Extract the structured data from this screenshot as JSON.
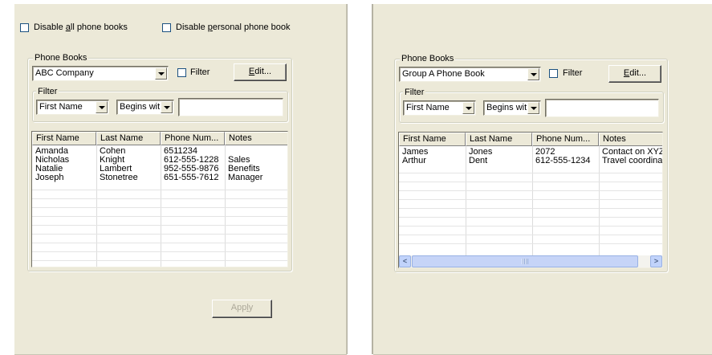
{
  "left": {
    "disable_all_label_pre": "Disable ",
    "disable_all_label_ul": "a",
    "disable_all_label_post": "ll phone books",
    "disable_personal_label_pre": "Disable ",
    "disable_personal_label_ul": "p",
    "disable_personal_label_post": "ersonal phone book",
    "phone_books_legend": "Phone Books",
    "phone_book_value": "ABC Company",
    "filter_check_label": "Filter",
    "edit_pre": "",
    "edit_ul": "E",
    "edit_post": "dit...",
    "filter_legend": "Filter",
    "filter_field_value": "First Name",
    "filter_op_value": "Begins wit",
    "filter_text_value": "",
    "columns": [
      "First Name",
      "Last Name",
      "Phone Num...",
      "Notes"
    ],
    "rows": [
      [
        "Amanda",
        "Cohen",
        "6511234",
        ""
      ],
      [
        "Nicholas",
        "Knight",
        "612-555-1228",
        "Sales"
      ],
      [
        "Natalie",
        "Lambert",
        "952-555-9876",
        "Benefits"
      ],
      [
        "Joseph",
        "Stonetree",
        "651-555-7612",
        "Manager"
      ]
    ],
    "apply_pre": "App",
    "apply_ul": "l",
    "apply_post": "y"
  },
  "right": {
    "phone_books_legend": "Phone Books",
    "phone_book_value": "Group A Phone Book",
    "filter_check_label": "Filter",
    "edit_pre": "",
    "edit_ul": "E",
    "edit_post": "dit...",
    "filter_legend": "Filter",
    "filter_field_value": "First Name",
    "filter_op_value": "Begins wit",
    "filter_text_value": "",
    "columns": [
      "First Name",
      "Last Name",
      "Phone Num...",
      "Notes"
    ],
    "rows": [
      [
        "James",
        "Jones",
        "2072",
        "Contact on XYZ"
      ],
      [
        "Arthur",
        "Dent",
        "612-555-1234",
        "Travel coordinator"
      ]
    ],
    "scroll_left_glyph": "<",
    "scroll_right_glyph": ">"
  },
  "colors": {
    "dialog_bg": "#ece9d8",
    "checkbox_border": "#1c5180",
    "scrollbar_accent": "#98b1e4",
    "disabled_text": "#aca899"
  }
}
